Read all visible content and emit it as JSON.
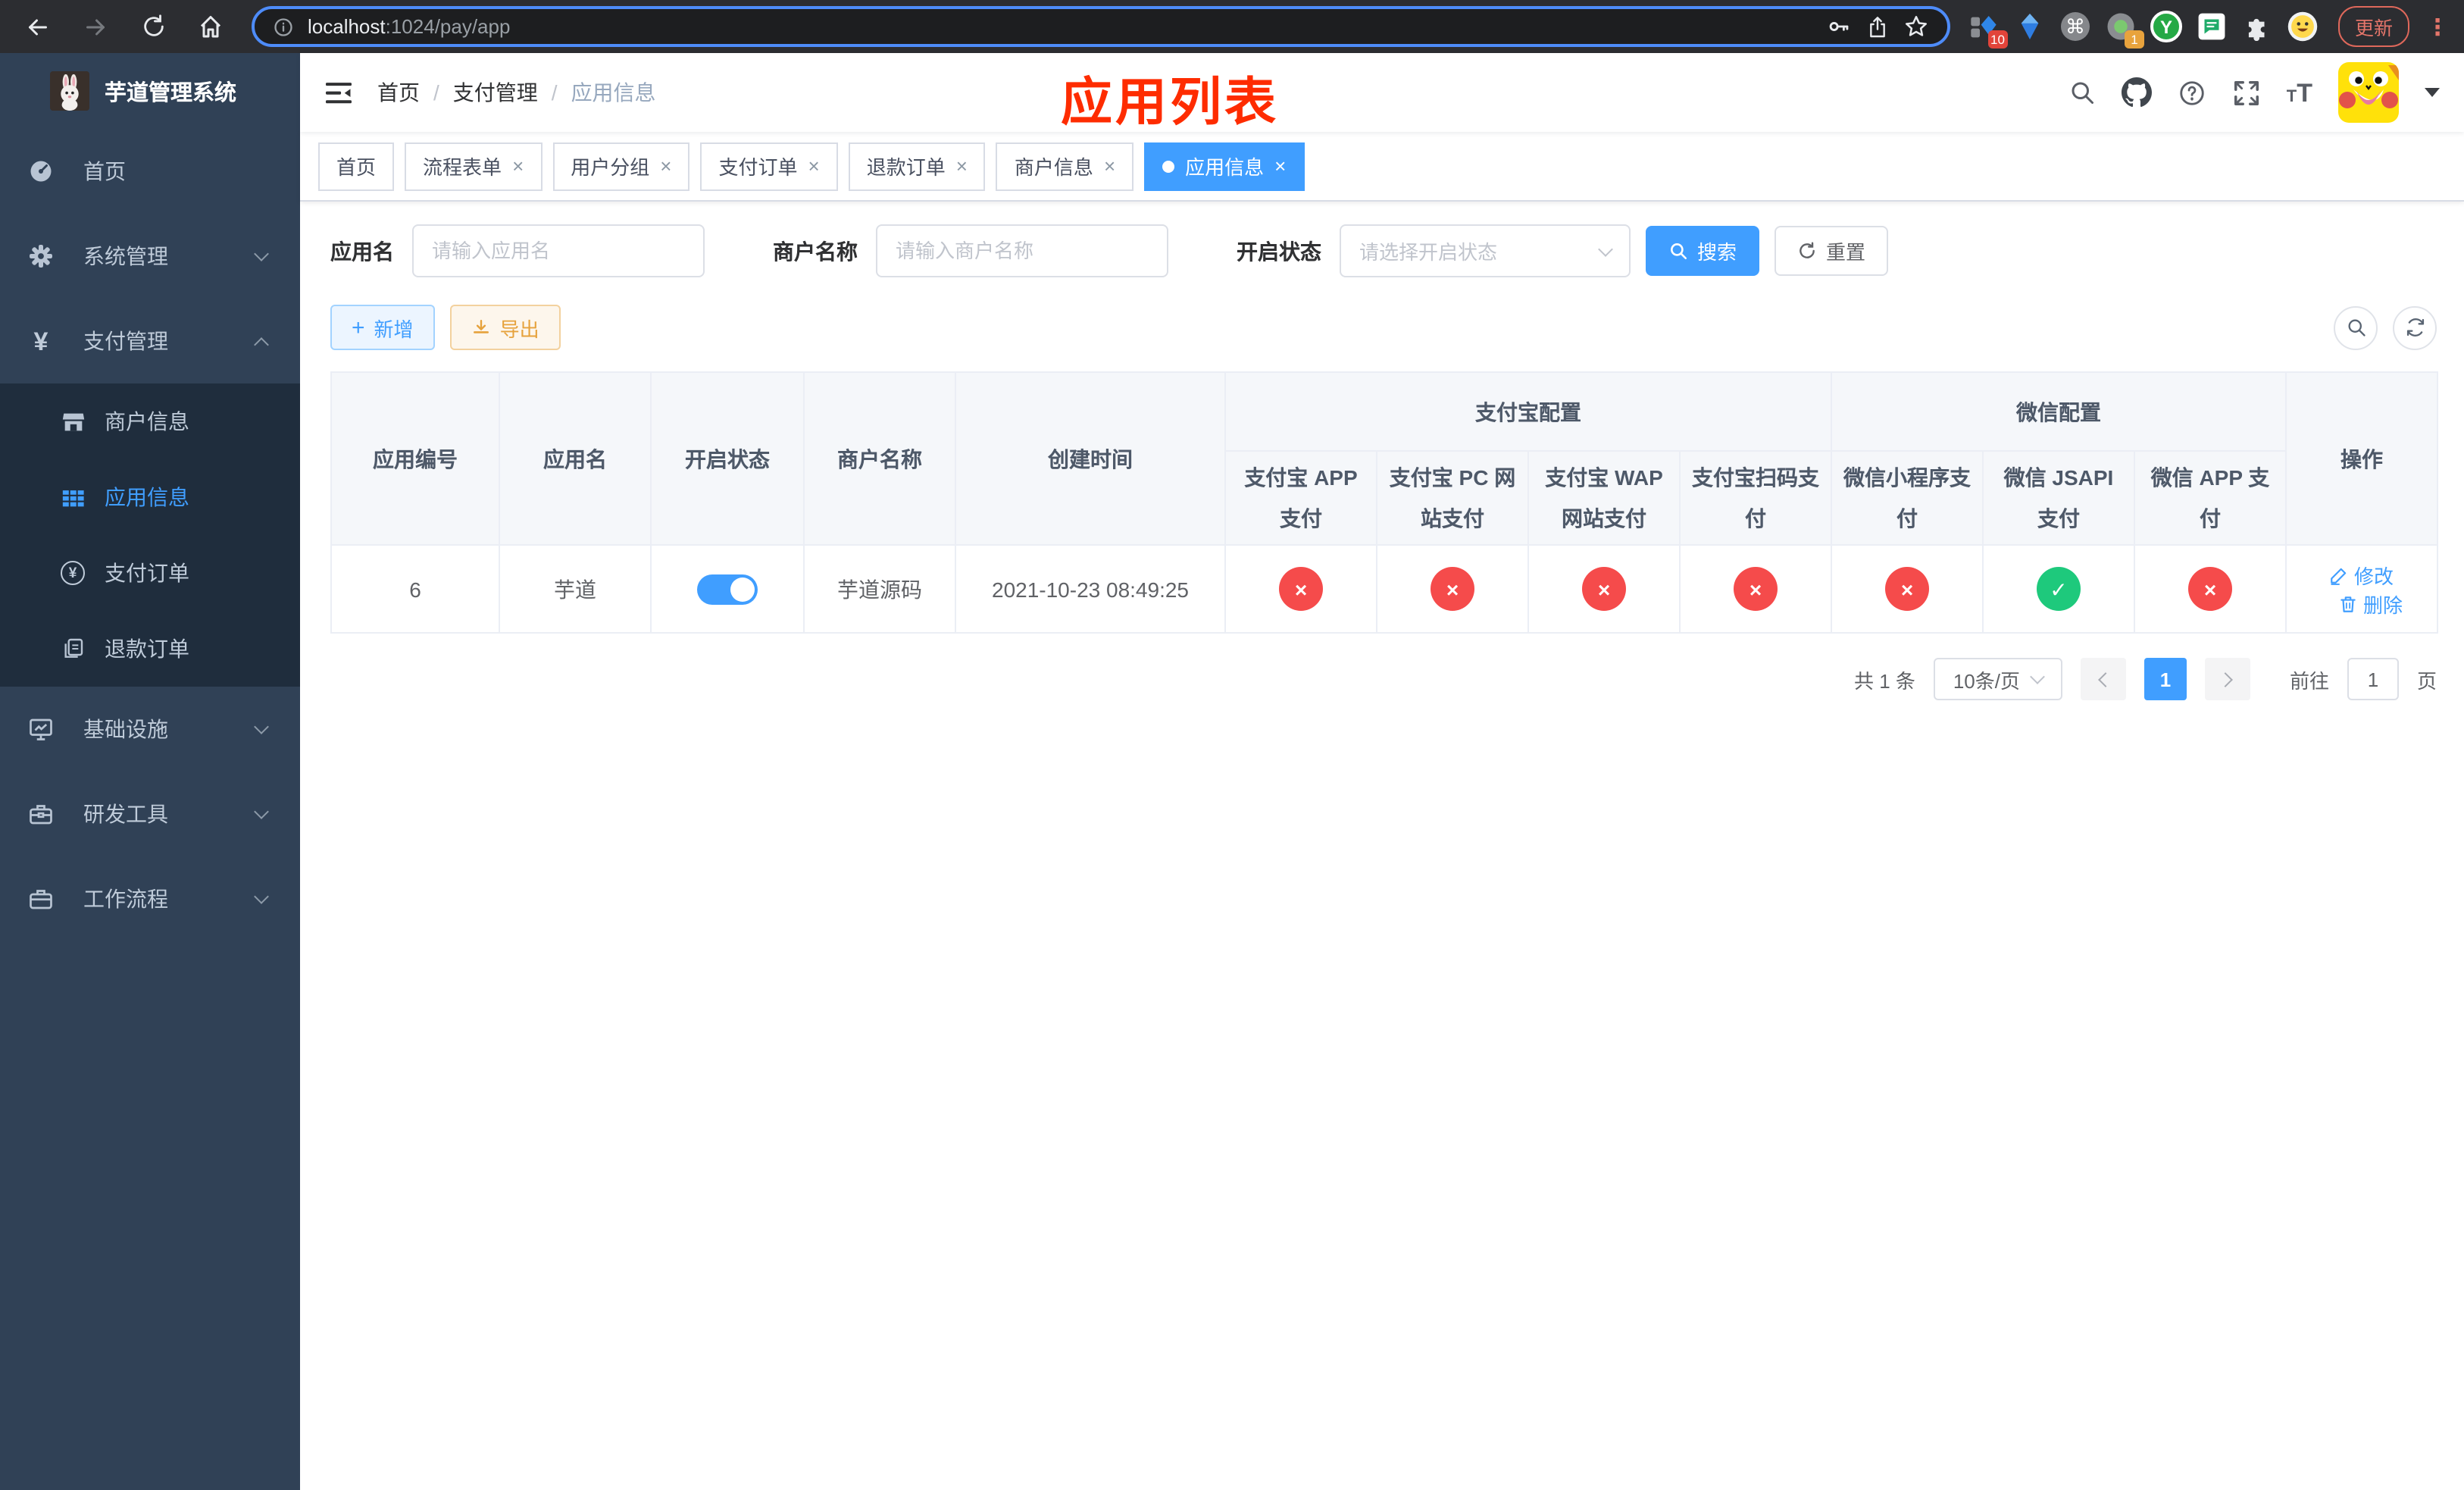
{
  "browser": {
    "url_host": "localhost",
    "url_path": ":1024/pay/app",
    "update_label": "更新",
    "badges": {
      "ext10": "10",
      "ext1": "1"
    },
    "cmd_glyph": "⌘",
    "y_glyph": "Y",
    "dots_glyph": "⋮"
  },
  "sidebar": {
    "title": "芋道管理系统",
    "items": [
      {
        "label": "首页"
      },
      {
        "label": "系统管理"
      },
      {
        "label": "支付管理"
      },
      {
        "label": "商户信息"
      },
      {
        "label": "应用信息"
      },
      {
        "label": "支付订单"
      },
      {
        "label": "退款订单"
      },
      {
        "label": "基础设施"
      },
      {
        "label": "研发工具"
      },
      {
        "label": "工作流程"
      }
    ]
  },
  "breadcrumb": {
    "sep": "/",
    "items": [
      {
        "label": "首页"
      },
      {
        "label": "支付管理"
      },
      {
        "label": "应用信息"
      }
    ]
  },
  "annotation": {
    "title": "应用列表",
    "color": "#fe2c00"
  },
  "tabs": [
    {
      "label": "首页",
      "closable": false,
      "active": false
    },
    {
      "label": "流程表单",
      "closable": true,
      "active": false
    },
    {
      "label": "用户分组",
      "closable": true,
      "active": false
    },
    {
      "label": "支付订单",
      "closable": true,
      "active": false
    },
    {
      "label": "退款订单",
      "closable": true,
      "active": false
    },
    {
      "label": "商户信息",
      "closable": true,
      "active": false
    },
    {
      "label": "应用信息",
      "closable": true,
      "active": true
    }
  ],
  "icons": {
    "close_glyph": "×",
    "plus_glyph": "+"
  },
  "search": {
    "app_name_label": "应用名",
    "app_name_placeholder": "请输入应用名",
    "merchant_label": "商户名称",
    "merchant_placeholder": "请输入商户名称",
    "status_label": "开启状态",
    "status_placeholder": "请选择开启状态",
    "search_button": "搜索",
    "reset_button": "重置"
  },
  "toolbar": {
    "add_label": "新增",
    "export_label": "导出"
  },
  "table": {
    "headers": {
      "app_id": "应用编号",
      "app_name": "应用名",
      "status": "开启状态",
      "merchant": "商户名称",
      "created": "创建时间",
      "group_alipay": "支付宝配置",
      "group_wechat": "微信配置",
      "actions": "操作",
      "sub": [
        {
          "label": "支付宝 APP 支付"
        },
        {
          "label": "支付宝 PC 网站支付"
        },
        {
          "label": "支付宝 WAP 网站支付"
        },
        {
          "label": "支付宝扫码支付"
        },
        {
          "label": "微信小程序支付"
        },
        {
          "label": "微信 JSAPI 支付"
        },
        {
          "label": "微信 APP 支付"
        }
      ]
    },
    "row": {
      "app_id": "6",
      "app_name": "芋道",
      "status_on": true,
      "merchant": "芋道源码",
      "created": "2021-10-23 08:49:25",
      "statuses": [
        "no",
        "no",
        "no",
        "no",
        "no",
        "yes",
        "no"
      ],
      "edit_label": "修改",
      "delete_label": "删除"
    }
  },
  "pagination": {
    "total_text": "共 1 条",
    "page_size": "10条/页",
    "current_page": "1",
    "goto_label": "前往",
    "goto_value": "1",
    "page_suffix": "页"
  },
  "colors": {
    "accent": "#409eff",
    "success": "#1ec97c",
    "danger": "#f54b4b",
    "warning": "#e6a23c",
    "sidebar_bg": "#304156",
    "submenu_bg": "#1f2d3d"
  }
}
